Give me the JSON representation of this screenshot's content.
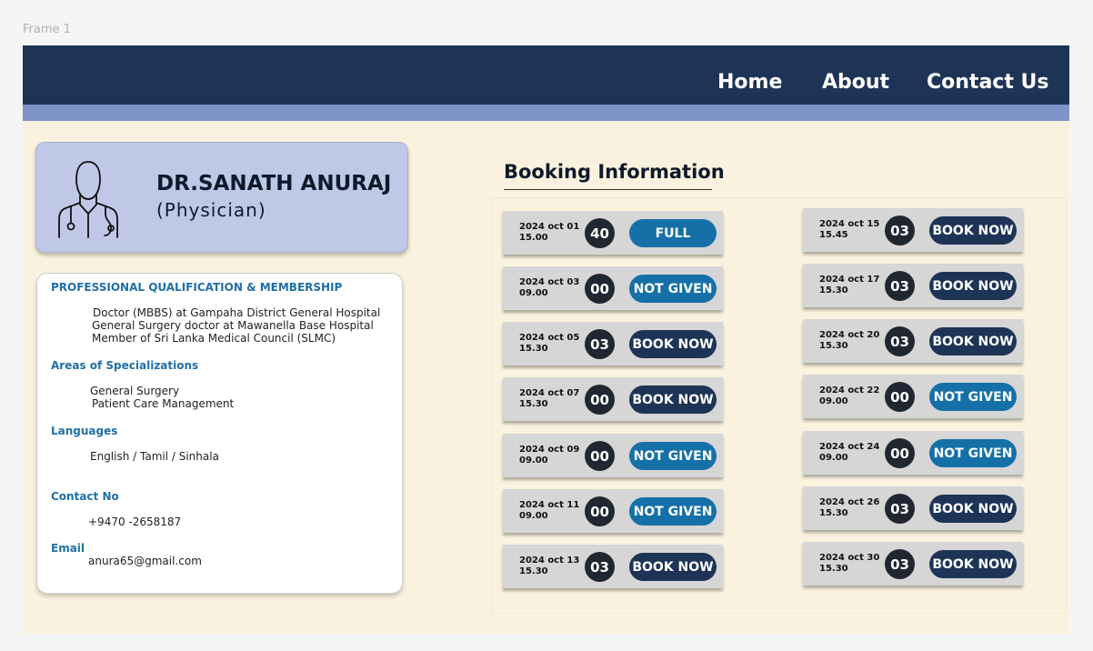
{
  "frame_label": "Frame 1",
  "nav": {
    "home": "Home",
    "about": "About",
    "contact": "Contact Us"
  },
  "doctor": {
    "name": "DR.SANATH ANURAJ",
    "title": "(Physician)"
  },
  "info": {
    "qualification_heading": "PROFESSIONAL QUALIFICATION & MEMBERSHIP",
    "qualifications": [
      "Doctor (MBBS) at Gampaha District General Hospital",
      "General Surgery doctor at Mawanella Base Hospital",
      "Member of Sri Lanka Medical Council (SLMC)"
    ],
    "specializations_heading": "Areas of Specializations",
    "specializations": [
      "General Surgery",
      "Patient Care Management"
    ],
    "languages_heading": "Languages",
    "languages": "English / Tamil / Sinhala",
    "contact_heading": "Contact No",
    "contact": "+9470 -2658187",
    "email_heading": "Email",
    "email": "anura65@gmail.com"
  },
  "booking": {
    "title": "Booking Information",
    "left": [
      {
        "date": "2024 oct 01",
        "time": "15.00",
        "count": "40",
        "status": "FULL"
      },
      {
        "date": "2024 oct 03",
        "time": "09.00",
        "count": "00",
        "status": "NOT GIVEN"
      },
      {
        "date": "2024 oct 05",
        "time": "15.30",
        "count": "03",
        "status": "BOOK NOW"
      },
      {
        "date": "2024 oct 07",
        "time": "15.30",
        "count": "00",
        "status": "BOOK NOW"
      },
      {
        "date": "2024 oct 09",
        "time": "09.00",
        "count": "00",
        "status": "NOT GIVEN"
      },
      {
        "date": "2024 oct 11",
        "time": "09.00",
        "count": "00",
        "status": "NOT GIVEN"
      },
      {
        "date": "2024 oct 13",
        "time": "15.30",
        "count": "03",
        "status": "BOOK NOW"
      }
    ],
    "right": [
      {
        "date": "2024 oct 15",
        "time": "15.45",
        "count": "03",
        "status": "BOOK NOW"
      },
      {
        "date": "2024 oct 17",
        "time": "15.30",
        "count": "03",
        "status": "BOOK NOW"
      },
      {
        "date": "2024 oct 20",
        "time": "15.30",
        "count": "03",
        "status": "BOOK NOW"
      },
      {
        "date": "2024 oct 22",
        "time": "09.00",
        "count": "00",
        "status": "NOT GIVEN"
      },
      {
        "date": "2024 oct 24",
        "time": "09.00",
        "count": "00",
        "status": "NOT GIVEN"
      },
      {
        "date": "2024 oct 26",
        "time": "15.30",
        "count": "03",
        "status": "BOOK NOW"
      },
      {
        "date": "2024 oct 30",
        "time": "15.30",
        "count": "03",
        "status": "BOOK NOW"
      }
    ]
  },
  "colors": {
    "navbar": "#1e3457",
    "subbar": "#7e93c7",
    "accent": "#1670a8",
    "book_button": "#1e3457",
    "background": "#faf2de"
  },
  "icons": {
    "doctor": "doctor-icon"
  }
}
